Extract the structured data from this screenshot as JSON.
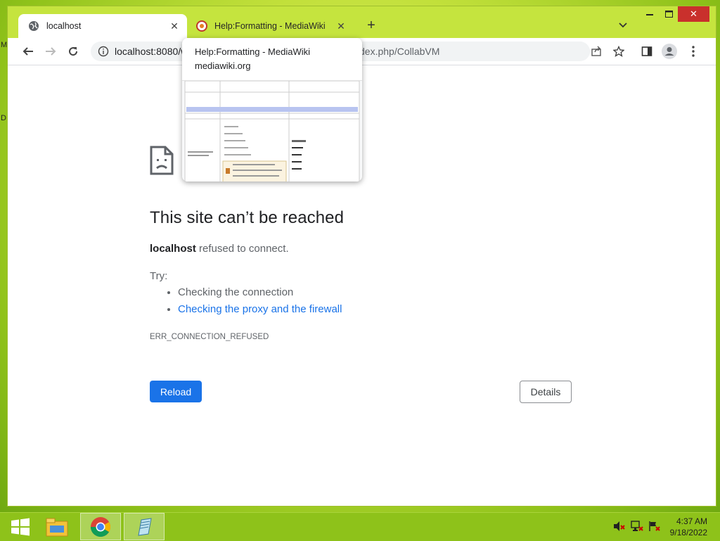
{
  "desktop": {
    "edge_labels": [
      "M",
      "D"
    ]
  },
  "tabs": [
    {
      "title": "localhost",
      "icon": "globe-icon",
      "active": true
    },
    {
      "title": "Help:Formatting - MediaWiki",
      "icon": "mediawiki-icon",
      "active": false
    }
  ],
  "window_controls": {
    "minimize": "minimize-icon",
    "maximize": "maximize-icon",
    "close": "close-icon"
  },
  "omnibox": {
    "url": "localhost:8080/w",
    "url_tail": "dex.php/CollabVM"
  },
  "hover_card": {
    "title": "Help:Formatting - MediaWiki",
    "domain": "mediawiki.org"
  },
  "error_page": {
    "title": "This site can’t be reached",
    "host": "localhost",
    "message": "refused to connect.",
    "try_label": "Try:",
    "suggestions": [
      "Checking the connection",
      "Checking the proxy and the firewall"
    ],
    "error_code": "ERR_CONNECTION_REFUSED",
    "reload_label": "Reload",
    "details_label": "Details"
  },
  "taskbar": {
    "items": [
      "start-icon",
      "file-explorer-icon",
      "chrome-icon",
      "notepad-icon"
    ],
    "tray": [
      "volume-muted-icon",
      "network-icon",
      "flag-icon"
    ],
    "time": "4:37 AM",
    "date": "9/18/2022"
  },
  "colors": {
    "accent": "#1a73e8",
    "desktop": "#8ec21a",
    "error_text": "#5f6368"
  }
}
